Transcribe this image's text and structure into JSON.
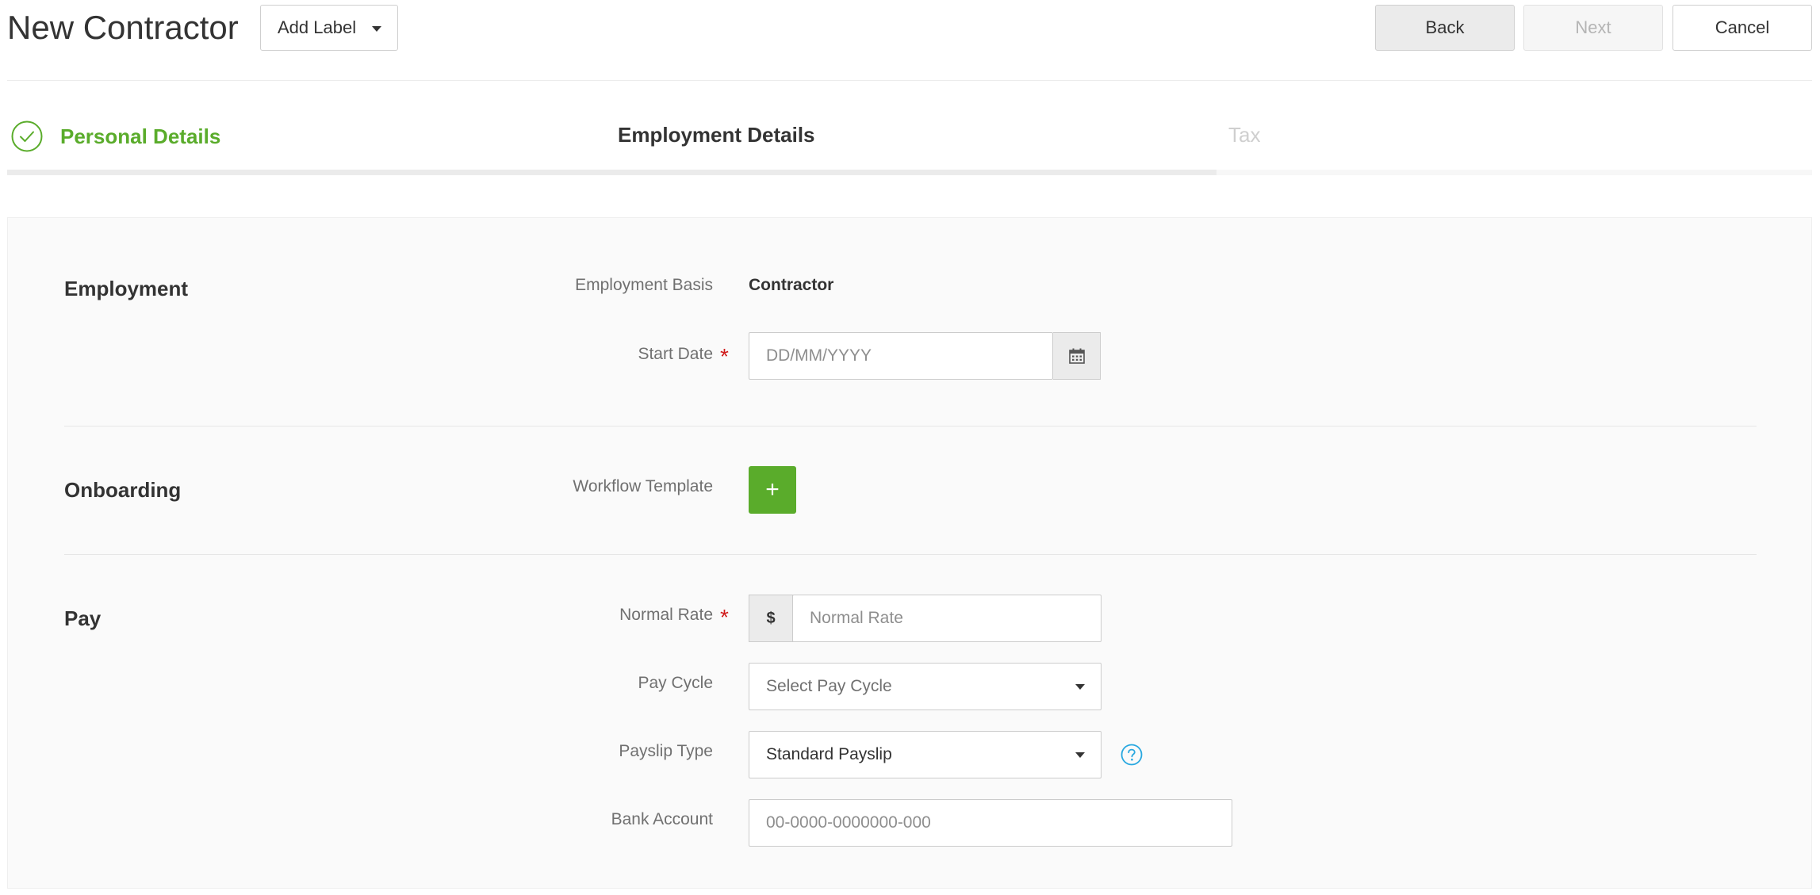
{
  "header": {
    "title": "New Contractor",
    "add_label": "Add Label",
    "back_label": "Back",
    "next_label": "Next",
    "cancel_label": "Cancel"
  },
  "stepper": {
    "steps": [
      {
        "label": "Personal Details",
        "state": "completed"
      },
      {
        "label": "Employment Details",
        "state": "active"
      },
      {
        "label": "Tax",
        "state": "upcoming"
      }
    ],
    "progress_percent": 67,
    "icons": {
      "completed": "check-circle-icon"
    }
  },
  "form": {
    "employment": {
      "title": "Employment",
      "employment_basis_label": "Employment Basis",
      "employment_basis_value": "Contractor",
      "start_date_label": "Start Date",
      "start_date_required": "*",
      "start_date_placeholder": "DD/MM/YYYY",
      "start_date_value": "",
      "calendar_icon": "calendar-icon"
    },
    "onboarding": {
      "title": "Onboarding",
      "workflow_template_label": "Workflow Template",
      "add_button_label": "+"
    },
    "pay": {
      "title": "Pay",
      "normal_rate_label": "Normal Rate",
      "normal_rate_required": "*",
      "currency_symbol": "$",
      "normal_rate_placeholder": "Normal Rate",
      "normal_rate_value": "",
      "pay_cycle_label": "Pay Cycle",
      "pay_cycle_value": "Select Pay Cycle",
      "payslip_type_label": "Payslip Type",
      "payslip_type_value": "Standard Payslip",
      "help_icon": "question-circle-icon",
      "bank_account_label": "Bank Account",
      "bank_account_placeholder": "00-0000-0000000-000",
      "bank_account_value": ""
    }
  },
  "colors": {
    "accent_green": "#5aac2b",
    "required_red": "#d01b1b",
    "help_blue": "#29a8e0",
    "disabled_text": "#b5b5b5"
  }
}
